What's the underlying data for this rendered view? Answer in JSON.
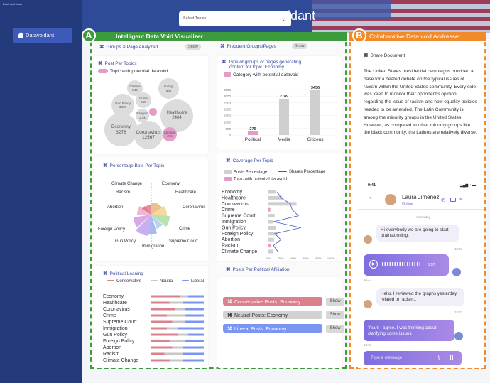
{
  "app": {
    "tiny_label": "Data Void Labs",
    "title": "Datavoidant",
    "nav_item": "Datavoidant",
    "select_placeholder": "Select Topics"
  },
  "panelA": {
    "badge": "A",
    "title": "Intelligent Data Void Visualizer"
  },
  "panelB": {
    "badge": "B",
    "title": "Collaborative Data void Addresser"
  },
  "groups": {
    "title": "Groups & Page Analyzed",
    "show": "Show"
  },
  "frequent": {
    "title": "Frequent Groups/Pages",
    "show": "Show"
  },
  "post_per_topic": {
    "title": "Post Per Topics",
    "legend": "Topic with potential datavoid",
    "bubbles": [
      {
        "name": "Climate",
        "value": "846"
      },
      {
        "name": "Immig.",
        "value": "694"
      },
      {
        "name": "Crime",
        "value": "555"
      },
      {
        "name": "Gun Policy",
        "value": "3890"
      },
      {
        "name": "Religion",
        "value": "2.4k"
      },
      {
        "name": "Abortion",
        "value": ""
      },
      {
        "name": "Healthcare",
        "value": "2404"
      },
      {
        "name": "Economy",
        "value": "3278"
      },
      {
        "name": "Coronavirus",
        "value": "12567"
      },
      {
        "name": "Abortion",
        "value": "276"
      }
    ]
  },
  "type_groups": {
    "title_line1": "Type of groups or pages generating",
    "title_line2": "content for topic: Economy",
    "legend": "Category with potential datavoid"
  },
  "percentage_bots": {
    "title": "Percentage Bots  Per Topic",
    "labels": [
      "Climate Change",
      "Economy",
      "Racism",
      "Healthcare",
      "Abortion",
      "Coronavirus",
      "Foreign Policy",
      "Crime",
      "Gun Policy",
      "Supreme Court",
      "Immigration"
    ]
  },
  "coverage": {
    "title": "Coverage Per Topic",
    "legend_posts": "Posts Percentage",
    "legend_shares": "Shares Percentage",
    "legend_void": "Topic with potential datavoid",
    "topics": [
      "Economy",
      "Healthcare",
      "Coronavirus",
      "Crime",
      "Supreme Court",
      "Inmigration",
      "Gun Policy",
      "Foreign Policy",
      "Abortion",
      "Racism",
      "Climate Change"
    ],
    "ticks": [
      "0%",
      "20%",
      "40%",
      "60%",
      "80%",
      "100%"
    ],
    "posts": [
      12,
      22,
      45,
      3,
      10,
      8,
      12,
      14,
      9,
      4,
      7
    ],
    "shares": [
      14,
      20,
      35,
      38,
      48,
      8,
      52,
      10,
      20,
      8,
      15
    ]
  },
  "posts_affiliation": {
    "title": "Posts Per Political Affiliation"
  },
  "political_leaning": {
    "title": "Political Leaning",
    "legend": [
      "Conservative",
      "Neutral",
      "Liberal"
    ],
    "topics": [
      "Economy",
      "Healthcare",
      "Coronavirus",
      "Crime",
      "Supreme Court",
      "Inmigration",
      "Gun Policy",
      "Foreign Policy",
      "Abortion",
      "Racism",
      "Climate Change"
    ],
    "shares": [
      [
        0.55,
        0.15,
        0.3
      ],
      [
        0.35,
        0.25,
        0.4
      ],
      [
        0.45,
        0.2,
        0.35
      ],
      [
        0.3,
        0.35,
        0.35
      ],
      [
        0.4,
        0.25,
        0.35
      ],
      [
        0.3,
        0.2,
        0.5
      ],
      [
        0.5,
        0.2,
        0.3
      ],
      [
        0.35,
        0.3,
        0.35
      ],
      [
        0.4,
        0.2,
        0.4
      ],
      [
        0.25,
        0.35,
        0.4
      ],
      [
        0.35,
        0.25,
        0.4
      ]
    ]
  },
  "affiliation_posts": {
    "conservative": "Conservative Posts: Economy",
    "neutral": "Neutral Posts: Economy",
    "liberal": "Liberal Posts: Economy",
    "show": "Show"
  },
  "share": {
    "title": "Share Document",
    "text": "The United States presidential campaigns provided a base for a heated debate on the typical issues of racism within the United States community. Every side was keen to monitor their opponent's opinion regarding the issue of racism and how equality policies needed to be amended. The Latin Community is among the minority groups in the United States. However, as compared to other minority groups like the black community, the Latinos are relatively diverse."
  },
  "chat": {
    "time": "9:41",
    "name": "Laura Jimenez",
    "status": "Online",
    "day": "Yesterday",
    "messages": [
      {
        "text": "Hi everybody we are going to start  brainstorming.",
        "time": "18:27"
      },
      {
        "duration": "0:37",
        "time": "18:27"
      },
      {
        "text": "Hello. I reviewed the graphs yesterday related to racism..",
        "time": "18:27"
      },
      {
        "text": "Yeah! I agree. I was thinking about clarifying some issues",
        "time": "18:27"
      }
    ],
    "input_placeholder": "Type a message"
  },
  "colors": {
    "sidebar": "#233b7a",
    "header": "#2f4b98",
    "accentA": "#3c9b3c",
    "accentB": "#f08a2a",
    "void": "#e49bc7",
    "gray": "#cfcfcf",
    "conservative": "#d9828c",
    "liberal": "#7a95f2",
    "neutral": "#c7c7c7",
    "shares_line": "#3b57c4"
  },
  "chart_data": [
    {
      "type": "bar",
      "categories": [
        "Political",
        "Media",
        "Citizens"
      ],
      "values": [
        276,
        2789,
        3456
      ],
      "ylim": [
        0,
        3500
      ],
      "yticks": [
        0,
        500,
        1000,
        1500,
        2000,
        2500,
        3000,
        3500
      ]
    }
  ]
}
